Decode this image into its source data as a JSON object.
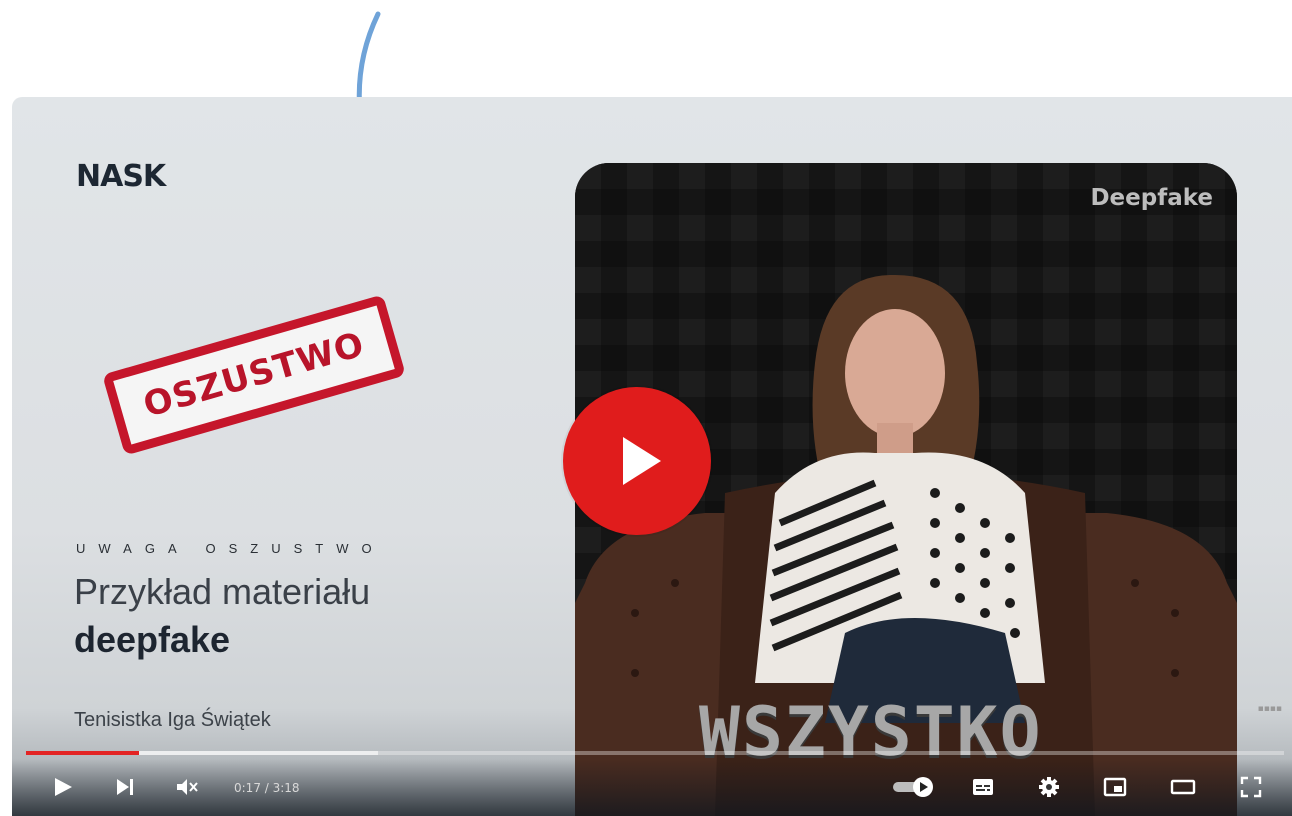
{
  "brand": {
    "logo": "NASK"
  },
  "stamp": {
    "text": "OSZUSTWO"
  },
  "slide": {
    "kicker": "UWAGA OSZUSTWO",
    "title_line": "Przykład materiału",
    "title_bold": "deepfake",
    "caption": "Tenisistka Iga Świątek"
  },
  "video": {
    "tag": "Deepfake",
    "subtitle": "WSZYSTKO"
  },
  "player": {
    "time": "0:17 / 3:18",
    "progress_played": 0.09,
    "progress_buffered": 0.28,
    "accent_color": "#e01c1c",
    "controls": [
      "play-icon",
      "next-icon",
      "volume-muted-icon",
      "autoplay-toggle-icon",
      "subtitles-icon",
      "settings-icon",
      "miniplayer-icon",
      "theater-icon",
      "fullscreen-icon"
    ]
  }
}
